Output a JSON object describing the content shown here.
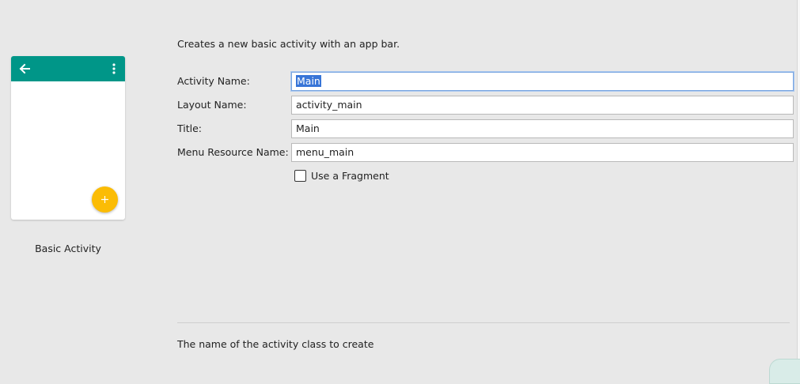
{
  "template": {
    "name": "Basic Activity",
    "appbar_color": "#009688",
    "fab_color": "#fbbc05",
    "icons": [
      "back-arrow-icon",
      "more-vert-icon",
      "add-icon"
    ]
  },
  "description": "Creates a new basic activity with an app bar.",
  "form": {
    "activity_name": {
      "label": "Activity Name:",
      "value": "Main"
    },
    "layout_name": {
      "label": "Layout Name:",
      "value": "activity_main"
    },
    "title": {
      "label": "Title:",
      "value": "Main"
    },
    "menu_resource_name": {
      "label": "Menu Resource Name:",
      "value": "menu_main"
    },
    "use_fragment": {
      "label": "Use a Fragment",
      "checked": false
    }
  },
  "help_text": "The name of the activity class to create",
  "colors": {
    "background": "#e8e8e8",
    "selection": "#3875d7",
    "focus_border": "#7aa6e0"
  }
}
